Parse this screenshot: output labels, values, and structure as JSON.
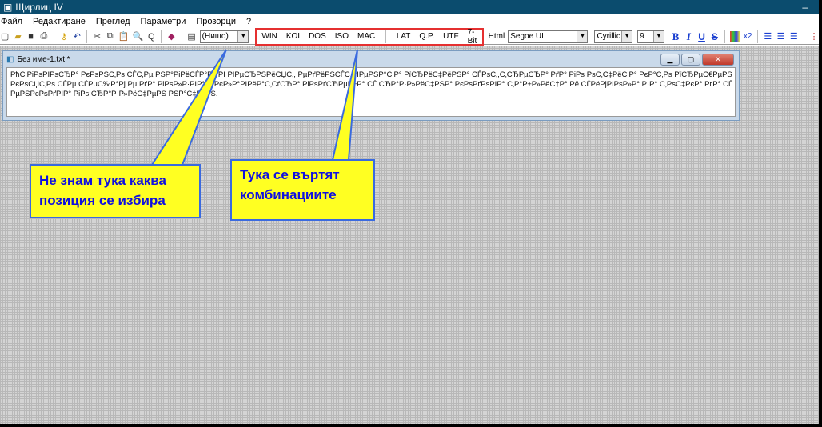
{
  "window": {
    "title": "Щирлиц IV",
    "minimize": "–"
  },
  "menu": [
    "Файл",
    "Редактиране",
    "Преглед",
    "Параметри",
    "Прозорци",
    "?"
  ],
  "toolbar": {
    "style_combo": "(Нищо)",
    "encodings": [
      "WIN",
      "KOI",
      "DOS",
      "ISO",
      "MAC"
    ],
    "conversions": [
      "LAT",
      "Q.P.",
      "UTF",
      "7-Bit"
    ],
    "html": "Html",
    "font": "Segoe UI",
    "charset": "Cyrillic",
    "size": "9",
    "bold": "B",
    "italic": "I",
    "underline": "U",
    "strike": "S",
    "subscript": "x2"
  },
  "document": {
    "title": "Без име-1.txt *",
    "lines": [
      "РћС‚РіРѕРІРѕСЂР° РєРѕРЅС‚Рѕ СЃС‚Рµ РЅР°РіРёСЃР°Р» РІ РІРµСЂРЅРёСЏС‚, РµРґРёРЅСЃС‚РІРµРЅР°С‚Р° РїСЂРёС‡РёРЅР° СЃРѕС‚,С‚СЂРµСЂР° РґР° РіРѕ РѕС‚С‡РёС‚Р° РєР°С‚Рѕ РїСЂРµС€РµРЅ Р·Р°",
      "РєРѕСЏС‚Рѕ СЃРµ СЃРµС‰Р°Рј Рµ РґР° РіРѕР»Р·РІР°С‚ РєР»Р°РІРёР°С‚СѓСЂР° РіРѕРґСЂРµР±Р° СЃ СЂР°Р·Р»РёС‡РЅР° РєРѕРґРѕРІР° С‚Р°Р±Р»РёС†Р° Рё СЃРёРјРІРѕР»Р° Р·Р° С‚РѕС‡РєР° РґР° СЃРµ",
      "РµРЅРєРѕРґРІР° РіРѕ СЂР°Р·Р»РёС‡РµРЅ РЅР°С‡РёРЅ."
    ]
  },
  "callouts": [
    "Не знам тука каква позиция се избира",
    "Тука се въртят комбинациите"
  ]
}
